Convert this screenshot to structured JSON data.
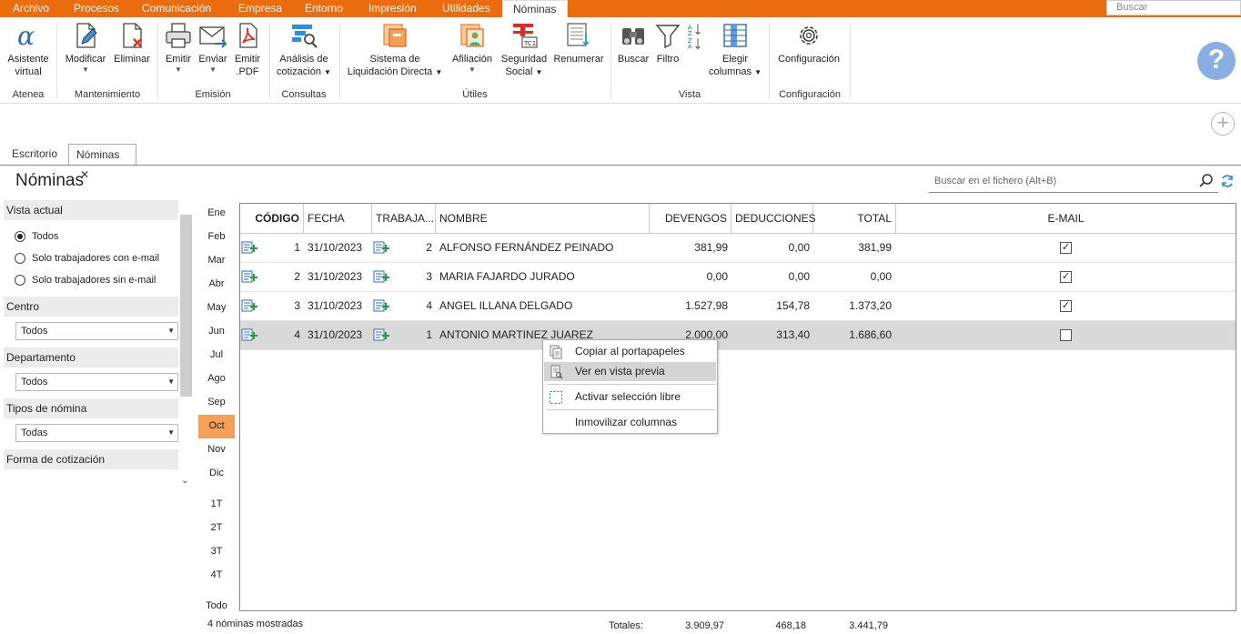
{
  "menubar": {
    "items": [
      "Archivo",
      "Procesos",
      "Comunicación",
      "Empresa",
      "Entorno",
      "Impresión",
      "Utilidades",
      "Nóminas"
    ],
    "active": "Nóminas",
    "search_placeholder": "Buscar"
  },
  "ribbon": {
    "buttons": {
      "asistente": [
        "Asistente",
        "virtual"
      ],
      "modificar": "Modificar",
      "eliminar": "Eliminar",
      "emitir": "Emitir",
      "enviar": "Enviar",
      "emitir_pdf": [
        "Emitir",
        ".PDF"
      ],
      "analisis": [
        "Análisis de",
        "cotización"
      ],
      "sistema": [
        "Sistema de",
        "Liquidación Directa"
      ],
      "afiliacion": "Afiliación",
      "seguridad": [
        "Seguridad",
        "Social"
      ],
      "renumerar": "Renumerar",
      "buscar": "Buscar",
      "filtro": "Filtro",
      "elegir": [
        "Elegir",
        "columnas"
      ],
      "configuracion": "Configuración"
    },
    "groups": {
      "atenea": "Atenea",
      "mantenimiento": "Mantenimiento",
      "emision": "Emisión",
      "consultas": "Consultas",
      "utiles": "Útiles",
      "vista": "Vista",
      "configuracion": "Configuración"
    },
    "help_glyph": "?"
  },
  "tabs": [
    {
      "label": "Escritorio"
    },
    {
      "label": "Nóminas",
      "close": "✕"
    }
  ],
  "page": {
    "title": "Nóminas",
    "search_placeholder": "Buscar en el fichero (Alt+B)"
  },
  "filters": {
    "vista_actual": {
      "label": "Vista actual",
      "options": [
        "Todos",
        "Solo trabajadores con e-mail",
        "Solo trabajadores sin e-mail"
      ],
      "selected": "Todos"
    },
    "centro": {
      "label": "Centro",
      "value": "Todos"
    },
    "departamento": {
      "label": "Departamento",
      "value": "Todos"
    },
    "tipos_nomina": {
      "label": "Tipos de nómina",
      "value": "Todas"
    },
    "forma_cotizacion": {
      "label": "Forma de cotización"
    }
  },
  "months": [
    "Ene",
    "Feb",
    "Mar",
    "Abr",
    "May",
    "Jun",
    "Jul",
    "Ago",
    "Sep",
    "Oct",
    "Nov",
    "Dic"
  ],
  "selected_month": "Oct",
  "quarters": [
    "1T",
    "2T",
    "3T",
    "4T"
  ],
  "all_label": "Todo",
  "table": {
    "columns": [
      "CÓDIGO",
      "FECHA",
      "TRABAJA...",
      "NOMBRE",
      "DEVENGOS",
      "DEDUCCIONES",
      "TOTAL",
      "E-MAIL"
    ],
    "rows": [
      {
        "codigo": "1",
        "fecha": "31/10/2023",
        "trabajador": "2",
        "nombre": "ALFONSO FERNÁNDEZ PEINADO",
        "devengos": "381,99",
        "deducciones": "0,00",
        "total": "381,99",
        "email": true
      },
      {
        "codigo": "2",
        "fecha": "31/10/2023",
        "trabajador": "3",
        "nombre": "MARIA FAJARDO JURADO",
        "devengos": "0,00",
        "deducciones": "0,00",
        "total": "0,00",
        "email": true
      },
      {
        "codigo": "3",
        "fecha": "31/10/2023",
        "trabajador": "4",
        "nombre": "ANGEL ILLANA DELGADO",
        "devengos": "1.527,98",
        "deducciones": "154,78",
        "total": "1.373,20",
        "email": true
      },
      {
        "codigo": "4",
        "fecha": "31/10/2023",
        "trabajador": "1",
        "nombre": "ANTONIO MARTINEZ JUAREZ",
        "devengos": "2.000,00",
        "deducciones": "313,40",
        "total": "1.686,60",
        "email": false
      }
    ],
    "selected_row": 3
  },
  "context_menu": {
    "items": [
      "Copiar al portapapeles",
      "Ver en vista previa",
      "Activar selección libre",
      "Inmovilizar columnas"
    ],
    "hover": "Ver en vista previa"
  },
  "footer": {
    "count_text": "4 nóminas mostradas",
    "totals_label": "Totales:",
    "devengos": "3.909,97",
    "deducciones": "468,18",
    "total": "3.441,79"
  },
  "colors": {
    "accent": "#ea6c0c",
    "selected_month": "#f4a05a",
    "help": "#88aee4",
    "row_highlight": "#d9d9d9"
  }
}
